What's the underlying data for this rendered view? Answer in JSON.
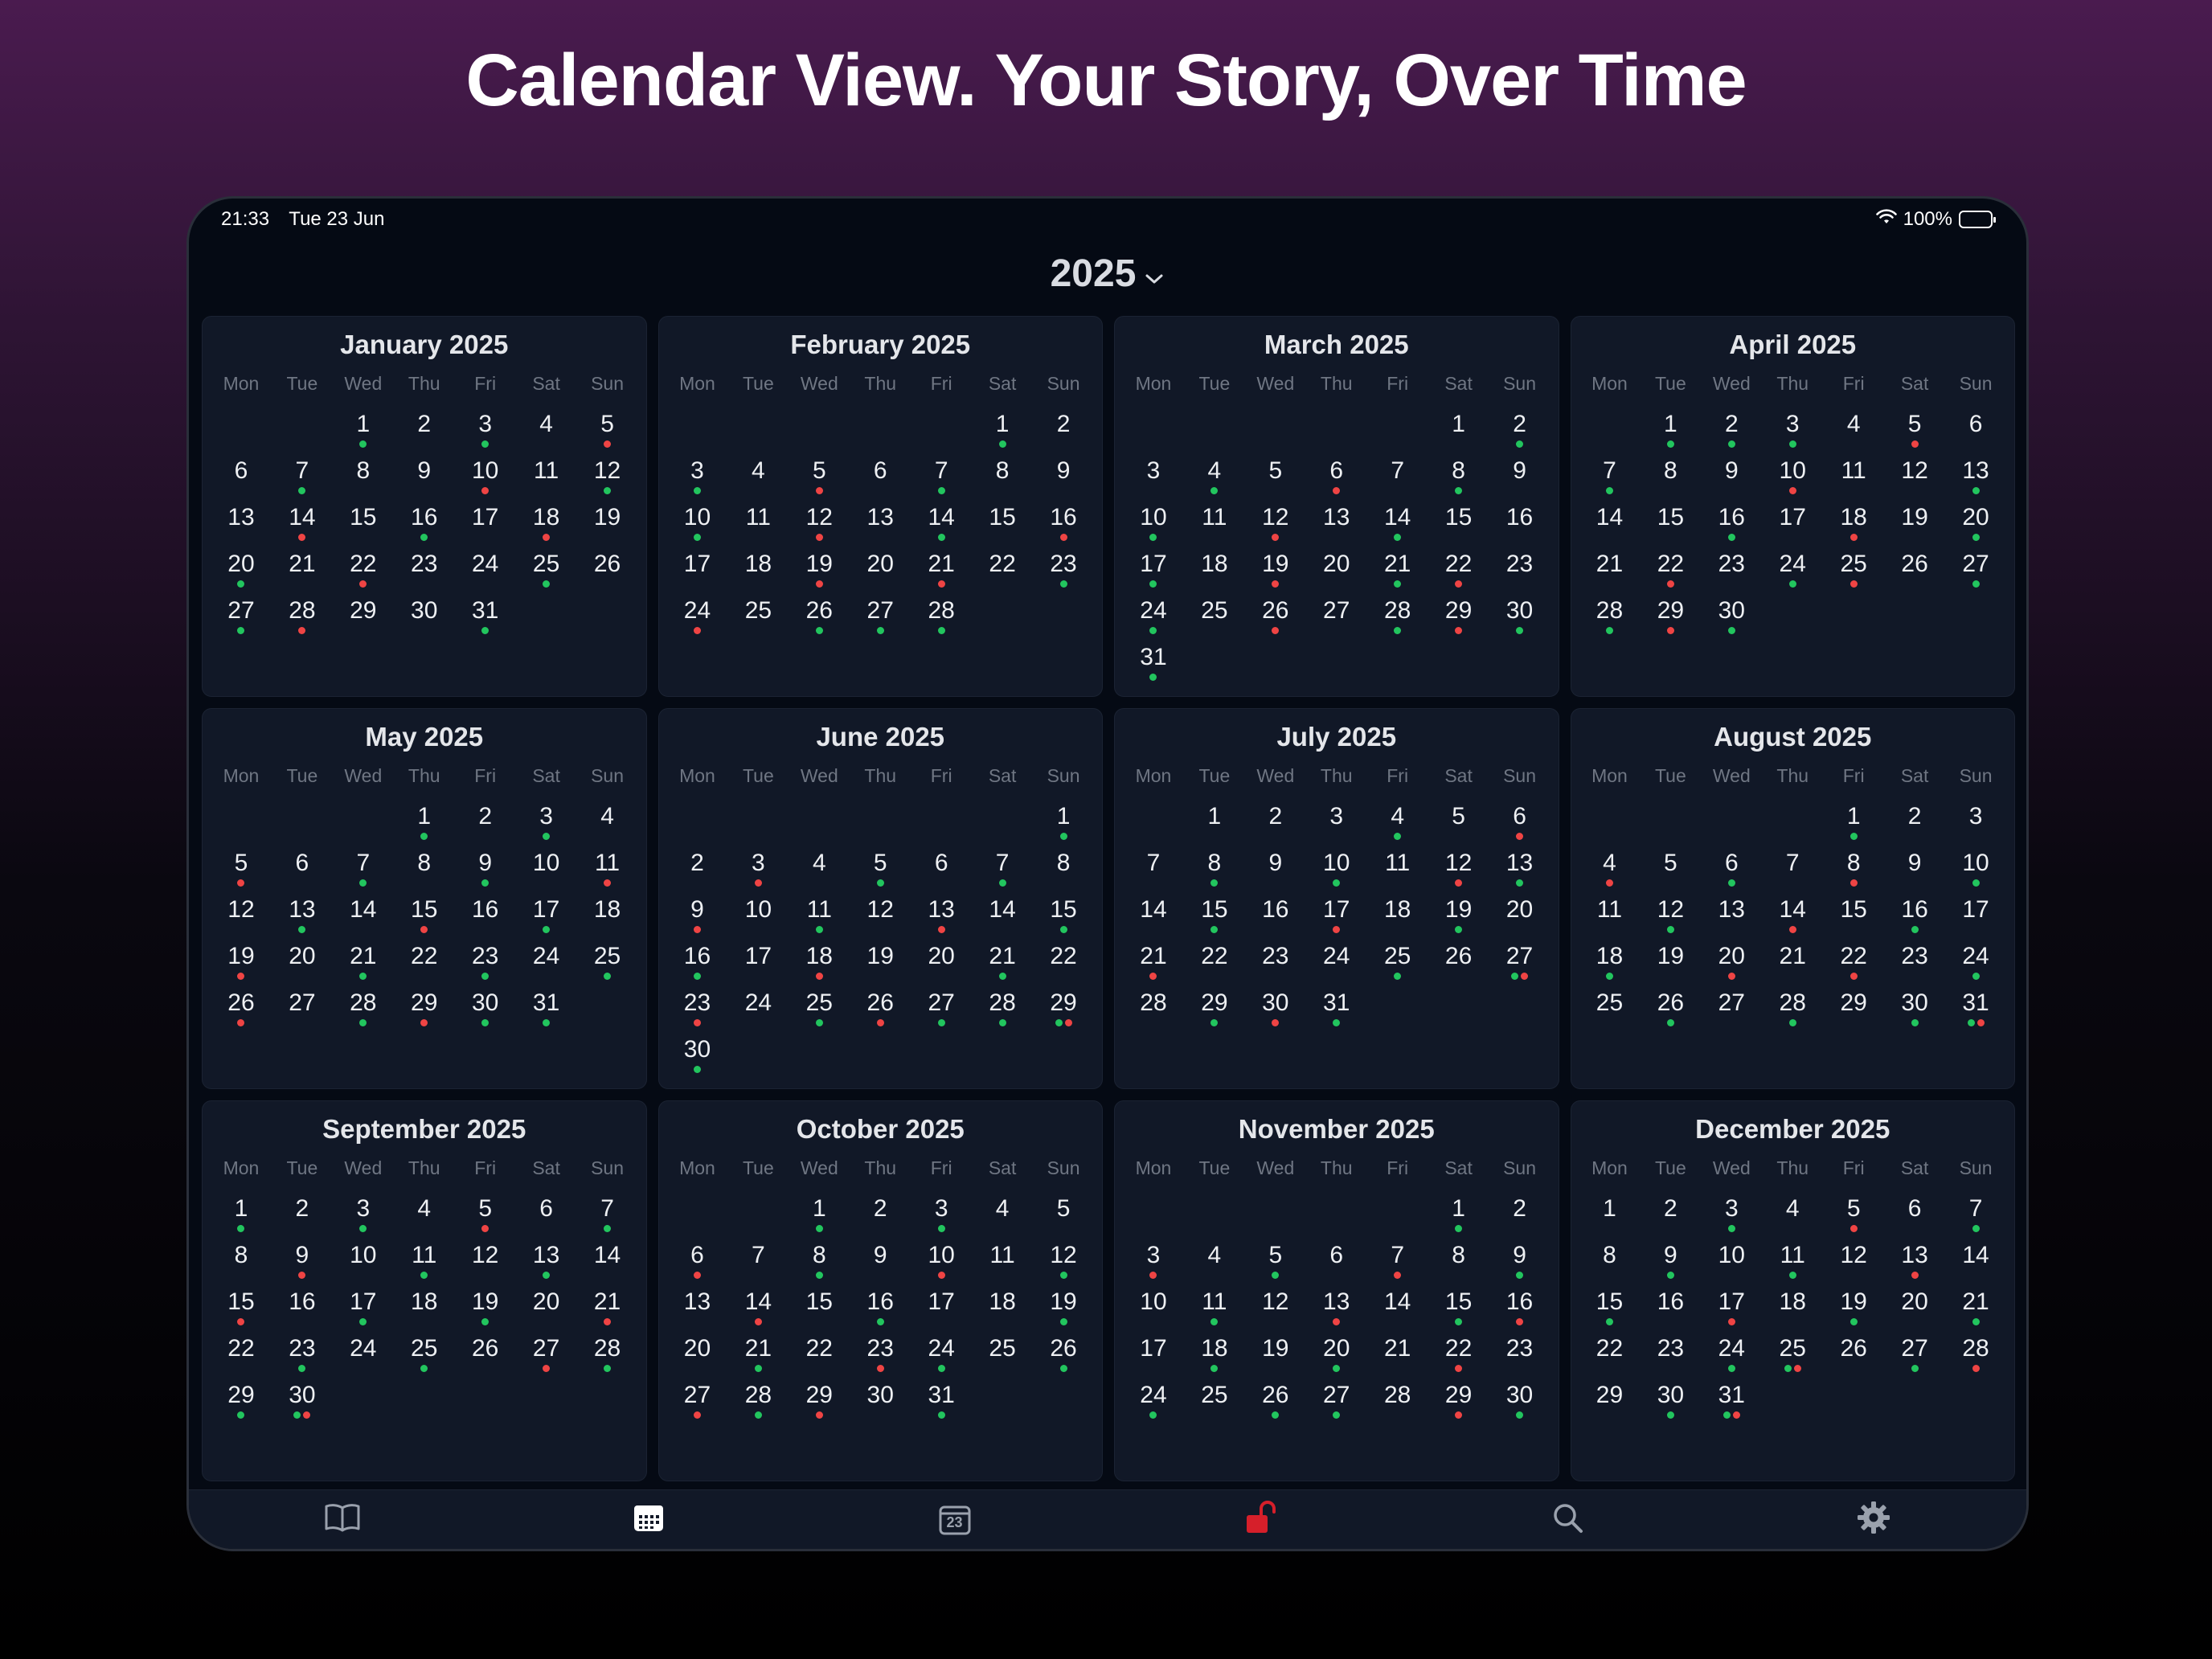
{
  "headline": "Calendar View. Your Story, Over Time",
  "status": {
    "time": "21:33",
    "date": "Tue 23 Jun",
    "battery": "100%"
  },
  "year_picker": {
    "label": "2025"
  },
  "weekdays": [
    "Mon",
    "Tue",
    "Wed",
    "Thu",
    "Fri",
    "Sat",
    "Sun"
  ],
  "colors": {
    "green": "#22c55e",
    "red": "#ef4444",
    "accent_lock": "#d61f2a"
  },
  "months": [
    {
      "title": "January 2025",
      "offset": 2,
      "days": 31,
      "dots": {
        "1": "g",
        "3": "g",
        "5": "r",
        "7": "g",
        "10": "r",
        "12": "g",
        "14": "r",
        "16": "g",
        "18": "r",
        "20": "g",
        "22": "r",
        "25": "g",
        "27": "g",
        "28": "r",
        "31": "g"
      }
    },
    {
      "title": "February 2025",
      "offset": 5,
      "days": 28,
      "dots": {
        "1": "g",
        "3": "g",
        "5": "r",
        "7": "g",
        "10": "g",
        "12": "r",
        "14": "g",
        "16": "r",
        "19": "r",
        "21": "r",
        "23": "g",
        "24": "r",
        "26": "g",
        "27": "g",
        "28": "g"
      }
    },
    {
      "title": "March 2025",
      "offset": 5,
      "days": 31,
      "dots": {
        "2": "g",
        "4": "g",
        "6": "r",
        "8": "g",
        "10": "g",
        "12": "r",
        "14": "g",
        "17": "g",
        "19": "r",
        "21": "g",
        "22": "r",
        "24": "g",
        "26": "r",
        "28": "g",
        "29": "r",
        "30": "g",
        "31": "g"
      }
    },
    {
      "title": "April 2025",
      "offset": 1,
      "days": 30,
      "dots": {
        "1": "g",
        "2": "g",
        "3": "g",
        "5": "r",
        "7": "g",
        "10": "r",
        "13": "g",
        "16": "g",
        "18": "r",
        "20": "g",
        "22": "r",
        "24": "g",
        "25": "r",
        "27": "g",
        "28": "g",
        "29": "r",
        "30": "g"
      }
    },
    {
      "title": "May 2025",
      "offset": 3,
      "days": 31,
      "dots": {
        "1": "g",
        "3": "g",
        "5": "r",
        "7": "g",
        "9": "g",
        "11": "r",
        "13": "g",
        "15": "r",
        "17": "g",
        "19": "r",
        "21": "g",
        "23": "g",
        "25": "g",
        "26": "r",
        "28": "g",
        "29": "r",
        "30": "g",
        "31": "g"
      }
    },
    {
      "title": "June 2025",
      "offset": 6,
      "days": 30,
      "dots": {
        "1": "g",
        "3": "r",
        "5": "g",
        "7": "g",
        "9": "r",
        "11": "g",
        "13": "r",
        "15": "g",
        "16": "g",
        "18": "r",
        "21": "g",
        "23": "r",
        "25": "g",
        "26": "r",
        "27": "g",
        "28": "g",
        "29": "gr",
        "30": "g"
      }
    },
    {
      "title": "July 2025",
      "offset": 1,
      "days": 31,
      "dots": {
        "4": "g",
        "6": "r",
        "8": "g",
        "10": "g",
        "12": "r",
        "13": "g",
        "15": "g",
        "17": "r",
        "19": "g",
        "21": "r",
        "25": "g",
        "27": "gr",
        "29": "g",
        "30": "r",
        "31": "g"
      }
    },
    {
      "title": "August 2025",
      "offset": 4,
      "days": 31,
      "dots": {
        "1": "g",
        "4": "r",
        "6": "g",
        "8": "r",
        "10": "g",
        "12": "g",
        "14": "r",
        "16": "g",
        "18": "g",
        "20": "r",
        "22": "r",
        "24": "g",
        "26": "g",
        "28": "g",
        "30": "g",
        "31": "gr"
      }
    },
    {
      "title": "September 2025",
      "offset": 0,
      "days": 30,
      "dots": {
        "1": "g",
        "3": "g",
        "5": "r",
        "7": "g",
        "9": "r",
        "11": "g",
        "13": "g",
        "15": "r",
        "17": "g",
        "19": "g",
        "21": "r",
        "23": "g",
        "25": "g",
        "27": "r",
        "28": "g",
        "29": "g",
        "30": "gr"
      }
    },
    {
      "title": "October 2025",
      "offset": 2,
      "days": 31,
      "dots": {
        "1": "g",
        "3": "g",
        "6": "r",
        "8": "g",
        "10": "r",
        "12": "g",
        "14": "r",
        "16": "g",
        "19": "g",
        "21": "g",
        "23": "r",
        "24": "g",
        "26": "g",
        "27": "r",
        "28": "g",
        "29": "r",
        "31": "g"
      }
    },
    {
      "title": "November 2025",
      "offset": 5,
      "days": 30,
      "dots": {
        "1": "g",
        "3": "r",
        "5": "g",
        "7": "r",
        "9": "g",
        "11": "g",
        "13": "r",
        "15": "g",
        "16": "r",
        "18": "g",
        "20": "g",
        "22": "r",
        "24": "g",
        "26": "g",
        "27": "g",
        "29": "r",
        "30": "g"
      }
    },
    {
      "title": "December 2025",
      "offset": 0,
      "days": 31,
      "dots": {
        "3": "g",
        "5": "r",
        "7": "g",
        "9": "g",
        "11": "g",
        "13": "r",
        "15": "g",
        "17": "r",
        "19": "g",
        "21": "g",
        "24": "g",
        "25": "gr",
        "27": "g",
        "28": "r",
        "30": "g",
        "31": "gr"
      }
    }
  ],
  "tabs": [
    {
      "name": "journal-tab",
      "icon": "book-icon"
    },
    {
      "name": "calendar-tab",
      "icon": "calendar-grid-icon"
    },
    {
      "name": "today-tab",
      "icon": "calendar-day-icon",
      "label": "23"
    },
    {
      "name": "lock-tab",
      "icon": "unlocked-padlock-icon"
    },
    {
      "name": "search-tab",
      "icon": "search-icon"
    },
    {
      "name": "settings-tab",
      "icon": "gear-icon"
    }
  ]
}
